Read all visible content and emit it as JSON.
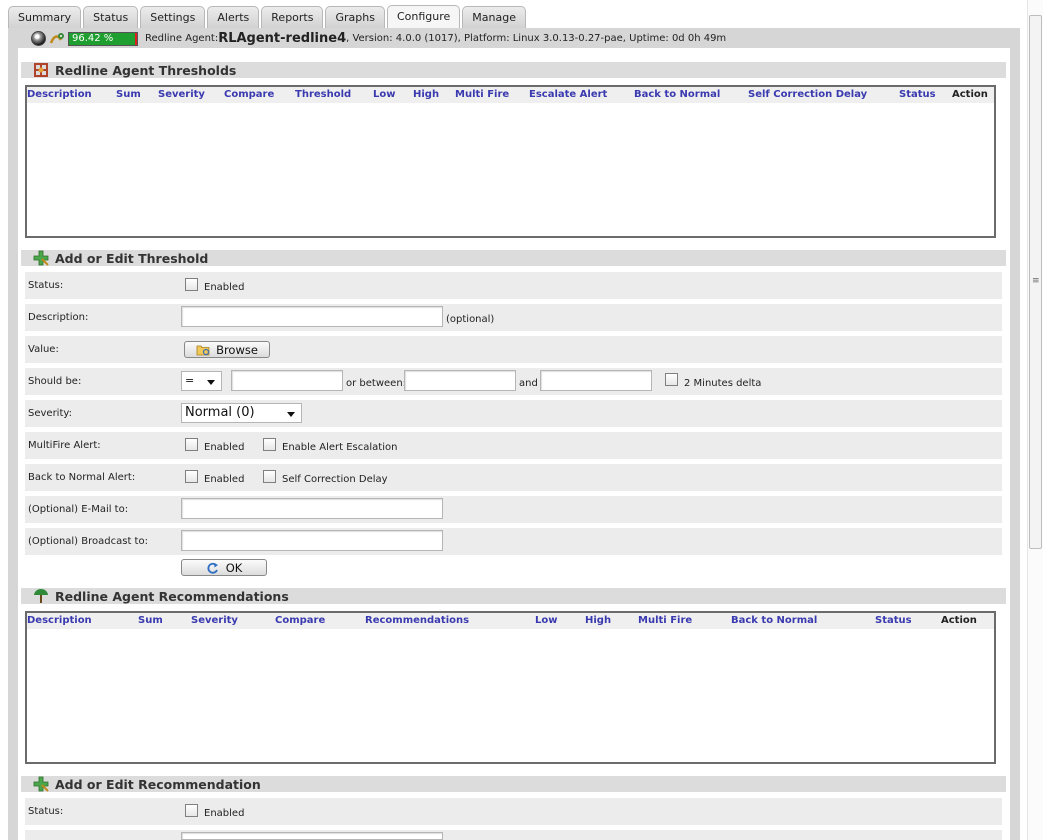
{
  "tabs": [
    "Summary",
    "Status",
    "Settings",
    "Alerts",
    "Reports",
    "Graphs",
    "Configure",
    "Manage"
  ],
  "active_tab": "Configure",
  "agent_bar": {
    "health_percent_text": "96.42 %",
    "health_fraction": 0.9642,
    "prefix": "Redline Agent: ",
    "agent_name": "RLAgent-redline4",
    "details": ", Version: 4.0.0 (1017), Platform: Linux 3.0.13-0.27-pae, Uptime: 0d 0h 49m"
  },
  "thresholds": {
    "title": "Redline Agent Thresholds",
    "columns": [
      "Description",
      "Sum",
      "Severity",
      "Compare",
      "Threshold",
      "Low",
      "High",
      "Multi Fire",
      "Escalate Alert",
      "Back to Normal",
      "Self Correction Delay",
      "Status",
      "Action"
    ]
  },
  "threshold_form": {
    "title": "Add or Edit Threshold",
    "status_label": "Status:",
    "enabled_label": "Enabled",
    "description_label": "Description:",
    "optional_note": "(optional)",
    "value_label": "Value:",
    "browse_label": "Browse",
    "should_be_label": "Should be:",
    "compare_value": "=",
    "or_between": "or between:",
    "and_label": "and",
    "delta_label": "2 Minutes delta",
    "severity_label": "Severity:",
    "severity_value": "Normal (0)",
    "multifire_label": "MultiFire Alert:",
    "escalation_label": "Enable Alert Escalation",
    "back_normal_label": "Back to Normal Alert:",
    "self_correction_label": "Self Correction Delay",
    "email_label": "(Optional) E-Mail to:",
    "broadcast_label": "(Optional) Broadcast to:",
    "ok_label": "OK"
  },
  "recommendations": {
    "title": "Redline Agent Recommendations",
    "columns": [
      "Description",
      "Sum",
      "Severity",
      "Compare",
      "Recommendations",
      "Low",
      "High",
      "Multi Fire",
      "Back to Normal",
      "Status",
      "Action"
    ]
  },
  "recommendation_form": {
    "title": "Add or Edit Recommendation",
    "status_label": "Status:",
    "enabled_label": "Enabled"
  },
  "colors": {
    "column_header": "#3a3ab0",
    "health_good": "#1f9f2f",
    "health_bad": "#e02020"
  }
}
